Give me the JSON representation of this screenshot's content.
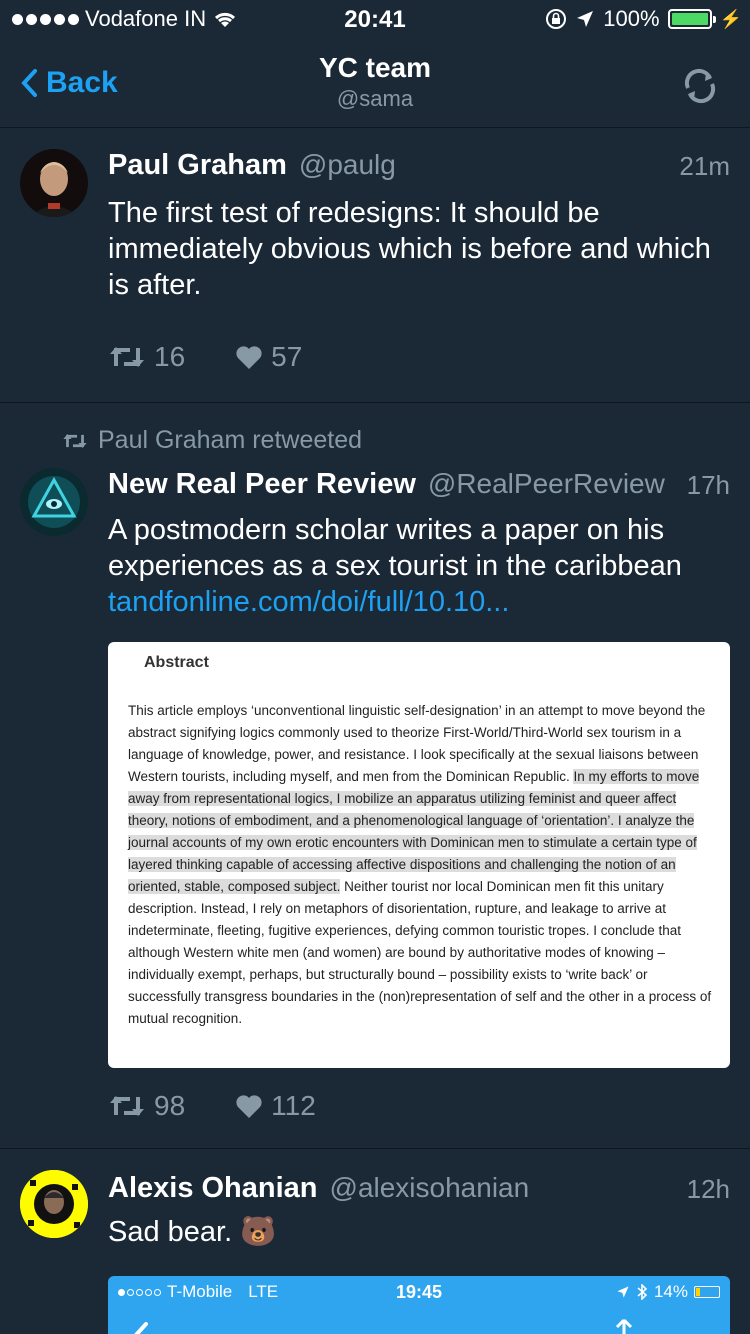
{
  "status_bar": {
    "carrier": "Vodafone IN",
    "time": "20:41",
    "battery": "100%"
  },
  "nav": {
    "back_label": "Back",
    "title": "YC team",
    "subtitle": "@sama"
  },
  "tweets": [
    {
      "name": "Paul Graham",
      "handle": "@paulg",
      "time": "21m",
      "text": "The first test of redesigns: It should be immediately obvious which is before and which is after.",
      "retweets": "16",
      "likes": "57"
    },
    {
      "retweeted_by": "Paul Graham retweeted",
      "name": "New Real Peer Review",
      "handle": "@RealPeerReview",
      "time": "17h",
      "text": "A postmodern scholar writes a paper on his experiences as a sex tourist in the caribbean",
      "link": "tandfonline.com/doi/full/10.10...",
      "card": {
        "title": "Abstract",
        "body_part1": "This article employs ‘unconventional linguistic self-designation’ in an attempt to move beyond the abstract signifying logics commonly used to theorize First-World/Third-World sex tourism in a language of knowledge, power, and resistance. I look specifically at the sexual liaisons between Western tourists, including myself, and men from the Dominican Republic. ",
        "body_highlight": "In my efforts to move away from representational logics, I mobilize an apparatus utilizing feminist and queer affect theory, notions of embodiment, and a phenomenological language of ‘orientation’. I analyze the journal accounts of my own erotic encounters with Dominican men to stimulate a certain type of layered thinking capable of accessing affective dispositions and challenging the notion of an oriented, stable, composed subject.",
        "body_part2": " Neither tourist nor local Dominican men fit this unitary description. Instead, I rely on metaphors of disorientation, rupture, and leakage to arrive at indeterminate, fleeting, fugitive experiences, defying common touristic tropes. I conclude that although Western white men (and women) are bound by authoritative modes of knowing – individually exempt, perhaps, but structurally bound – possibility exists to ‘write back’ or successfully transgress boundaries in the (non)representation of self and the other in a process of mutual recognition."
      },
      "retweets": "98",
      "likes": "112"
    },
    {
      "name": "Alexis Ohanian",
      "handle": "@alexisohanian",
      "time": "12h",
      "text": "Sad bear. 🐻",
      "embed": {
        "carrier": "T-Mobile",
        "network": "LTE",
        "time": "19:45",
        "battery": "14%"
      }
    }
  ],
  "colors": {
    "background": "#1b2836",
    "accent": "#1da1f2",
    "muted": "#8899a6"
  }
}
